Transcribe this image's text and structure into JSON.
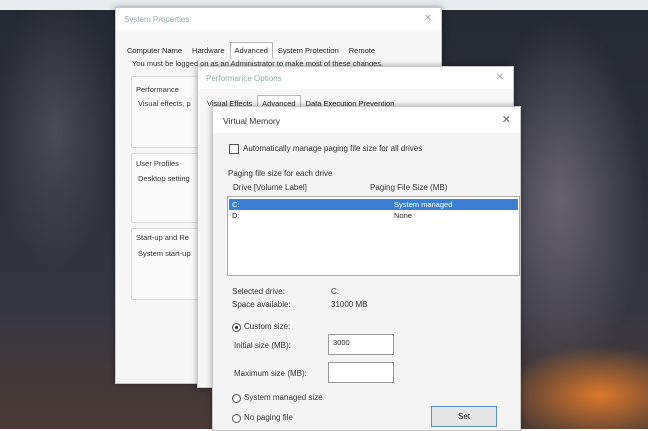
{
  "system_properties": {
    "title": "System Properties",
    "tabs": [
      "Computer Name",
      "Hardware",
      "Advanced",
      "System Protection",
      "Remote"
    ],
    "notice": "You must be logged on as an Administrator to make most of these changes.",
    "performance_heading": "Performance",
    "performance_text": "Visual effects, p",
    "user_profiles_heading": "User Profiles",
    "user_profiles_text": "Desktop setting",
    "startup_heading": "Start-up and Re",
    "startup_text": "System start-up"
  },
  "performance_options": {
    "title": "Performance Options",
    "tabs": [
      "Visual Effects",
      "Advanced",
      "Data Execution Prevention"
    ]
  },
  "virtual_memory": {
    "title": "Virtual Memory",
    "auto_manage_label": "Automatically manage paging file size for all drives",
    "auto_manage_checked": false,
    "section_label": "Paging file size for each drive",
    "col_drive": "Drive  [Volume Label]",
    "col_size": "Paging File Size (MB)",
    "drives": [
      {
        "drive": "C:",
        "size": "System managed",
        "selected": true
      },
      {
        "drive": "D:",
        "size": "None",
        "selected": false
      }
    ],
    "selected_drive_label": "Selected drive:",
    "selected_drive_value": "C:",
    "space_available_label": "Space available:",
    "space_available_value": "31000 MB",
    "custom_size_label": "Custom size:",
    "initial_size_label": "Initial size (MB):",
    "initial_size_value": "3000",
    "maximum_size_label": "Maximum size (MB):",
    "maximum_size_value": "",
    "system_managed_label": "System managed size",
    "no_paging_label": "No paging file",
    "selected_option": "custom",
    "set_button": "Set"
  },
  "icons": {
    "close": "close-icon"
  },
  "colors": {
    "selection": "#3a7fd4",
    "button_border": "#5a8fd0"
  }
}
